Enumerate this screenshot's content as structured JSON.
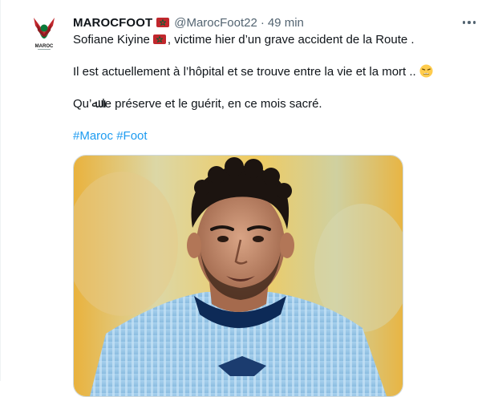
{
  "tweet": {
    "author_name": "MAROCFOOT",
    "handle": "@MarocFoot22",
    "separator": "·",
    "time": "49 min",
    "lines": [
      {
        "before_flag": "Sofiane Kiyine",
        "after_flag": ", victime hier d’un grave accident de la Route ."
      },
      {
        "text": "Il est actuellement à l’hôpital et se trouve entre la vie et la mort .."
      },
      {
        "text": "Qu’ﷲ le préserve et le guérit, en ce mois sacré."
      }
    ],
    "hashtags": [
      "#Maroc",
      "#Foot"
    ]
  },
  "avatar_logo_text": "MAROC",
  "icons": {
    "flag": "morocco-flag-icon",
    "emoji": "weary-face-emoji-icon",
    "more": "more-options-icon"
  },
  "colors": {
    "link": "#1d9bf0",
    "secondary_text": "#536471",
    "flag_red": "#c1272d",
    "flag_star": "#006233"
  }
}
